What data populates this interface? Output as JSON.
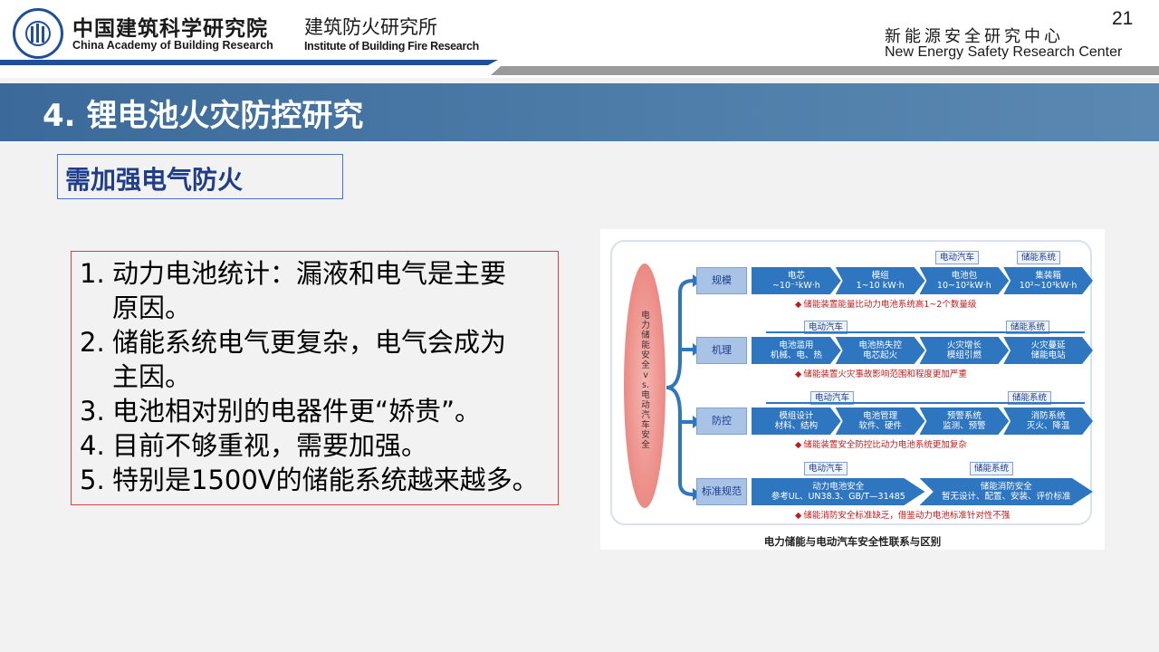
{
  "header": {
    "org_cn": "中国建筑科学研究院",
    "org_en": "China Academy of Building Research",
    "inst_cn": "建筑防火研究所",
    "inst_en": "Institute of Building Fire Research",
    "center_cn": "新能源安全研究中心",
    "center_en": "New Energy Safety Research Center",
    "page_number": "21"
  },
  "title": "4. 锂电池火灾防控研究",
  "subtitle": "需加强电气防火",
  "points": [
    {
      "num": "1.",
      "text": "动力电池统计：漏液和电气是主要",
      "cont": "原因。"
    },
    {
      "num": "2.",
      "text": "储能系统电气更复杂，电气会成为",
      "cont": "主因。"
    },
    {
      "num": "3.",
      "text": "电池相对别的电器件更“娇贵”。",
      "cont": ""
    },
    {
      "num": "4.",
      "text": "目前不够重视，需要加强。",
      "cont": ""
    },
    {
      "num": "5.",
      "text": "特别是1500V的储能系统越来越多。",
      "cont": ""
    }
  ],
  "diagram": {
    "ellipse_text": "电力储能安全vs.电动汽车安全",
    "rows": [
      {
        "label": "规模",
        "tags": [
          "电动汽车",
          "储能系统"
        ],
        "steps": [
          "电芯\n~10⁻¹kW·h",
          "模组\n1~10 kW·h",
          "电池包\n10~10²kW·h",
          "集装箱\n10²~10³kW·h"
        ],
        "note": "储能装置能量比动力电池系统高1~2个数量级"
      },
      {
        "label": "机理",
        "tags": [
          "电动汽车",
          "储能系统"
        ],
        "steps": [
          "电池滥用\n机械、电、热",
          "电池热失控\n电芯起火",
          "火灾增长\n模组引燃",
          "火灾蔓延\n储能电站"
        ],
        "note": "储能装置火灾事故影响范围和程度更加严重"
      },
      {
        "label": "防控",
        "tags": [
          "电动汽车",
          "储能系统"
        ],
        "steps": [
          "模组设计\n材料、结构",
          "电池管理\n软件、硬件",
          "预警系统\n监测、预警",
          "消防系统\n灭火、降温"
        ],
        "note": "储能装置安全防控比动力电池系统更加复杂"
      },
      {
        "label": "标准规范",
        "tags": [
          "电动汽车",
          "储能系统"
        ],
        "steps": [
          "动力电池安全\n参考UL、UN38.3、GB/T—31485",
          "储能消防安全\n暂无设计、配置、安装、评价标准"
        ],
        "note": "储能消防安全标准缺乏，借鉴动力电池标准针对性不强"
      }
    ],
    "caption": "电力储能与电动汽车安全性联系与区别"
  },
  "colors": {
    "title_bar": "#4a78a6",
    "brand_blue": "#1f4f99",
    "chevron_blue": "#2f76c1",
    "note_red": "#c01c1c",
    "box_red": "#e04040"
  }
}
